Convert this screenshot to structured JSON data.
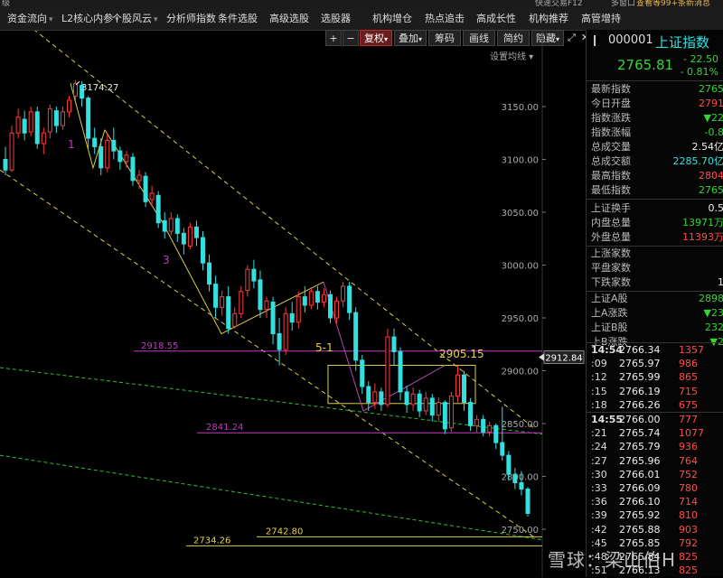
{
  "top_strip": {
    "left_text": "级",
    "right_a": "快速交易F12",
    "right_b": "多窗口",
    "right_c": "查看等99+条新消息"
  },
  "menu": {
    "items": [
      {
        "label": "资金流向",
        "dropdown": true
      },
      {
        "label": "L2核心内参",
        "dropdown": true
      },
      {
        "label": "个股风云",
        "dropdown": true
      },
      {
        "label": "分析师指数",
        "dropdown": false
      },
      {
        "label": "条件选股",
        "dropdown": false
      },
      {
        "label": "高级选股",
        "dropdown": false
      },
      {
        "label": "选股器",
        "dropdown": false
      },
      {
        "label": "机构增仓",
        "dropdown": false
      },
      {
        "label": "热点追击",
        "dropdown": false
      },
      {
        "label": "高成长性",
        "dropdown": false
      },
      {
        "label": "机构推荐",
        "dropdown": false
      },
      {
        "label": "高管增持",
        "dropdown": false
      }
    ]
  },
  "toolbar": {
    "plus": "+",
    "minus": "−",
    "fuquan": "复权",
    "diejia": "叠加",
    "chouma": "筹码",
    "huaxian": "画线",
    "jiantou": "简约",
    "yincang": "隐藏",
    "expand_icon": "expand-icon",
    "close_icon": "close-icon"
  },
  "settings_label": "设置均线",
  "chart_data": {
    "type": "candlestick",
    "ylim": [
      2730,
      3210
    ],
    "ticks": [
      3150,
      3100,
      3050,
      3000,
      2950,
      2900,
      2850,
      2800,
      2750
    ],
    "tick_labels": [
      "3150.00",
      "3100.00",
      "3050.00",
      "3000.00",
      "2950.00",
      "2900.00",
      "2850.00",
      "2800.00",
      "2750.00"
    ],
    "current_price_label": "2912.84",
    "current_price": 2912.84,
    "candles": [
      {
        "o": 3100,
        "h": 3112,
        "c": 3090,
        "l": 3085
      },
      {
        "o": 3090,
        "h": 3132,
        "c": 3125,
        "l": 3088
      },
      {
        "o": 3125,
        "h": 3148,
        "c": 3140,
        "l": 3120
      },
      {
        "o": 3138,
        "h": 3146,
        "c": 3125,
        "l": 3118
      },
      {
        "o": 3126,
        "h": 3150,
        "c": 3145,
        "l": 3122
      },
      {
        "o": 3145,
        "h": 3150,
        "c": 3115,
        "l": 3110
      },
      {
        "o": 3115,
        "h": 3130,
        "c": 3125,
        "l": 3105
      },
      {
        "o": 3126,
        "h": 3152,
        "c": 3148,
        "l": 3120
      },
      {
        "o": 3146,
        "h": 3150,
        "c": 3132,
        "l": 3125
      },
      {
        "o": 3132,
        "h": 3150,
        "c": 3145,
        "l": 3128
      },
      {
        "o": 3145,
        "h": 3160,
        "c": 3156,
        "l": 3140
      },
      {
        "o": 3160,
        "h": 3175,
        "c": 3172,
        "l": 3155
      },
      {
        "o": 3170,
        "h": 3174,
        "c": 3158,
        "l": 3150
      },
      {
        "o": 3158,
        "h": 3160,
        "c": 3120,
        "l": 3110
      },
      {
        "o": 3120,
        "h": 3130,
        "c": 3112,
        "l": 3105
      },
      {
        "o": 3112,
        "h": 3120,
        "c": 3092,
        "l": 3085
      },
      {
        "o": 3092,
        "h": 3125,
        "c": 3118,
        "l": 3088
      },
      {
        "o": 3118,
        "h": 3130,
        "c": 3108,
        "l": 3100
      },
      {
        "o": 3108,
        "h": 3112,
        "c": 3098,
        "l": 3090
      },
      {
        "o": 3098,
        "h": 3108,
        "c": 3104,
        "l": 3092
      },
      {
        "o": 3102,
        "h": 3106,
        "c": 3080,
        "l": 3075
      },
      {
        "o": 3080,
        "h": 3090,
        "c": 3085,
        "l": 3072
      },
      {
        "o": 3084,
        "h": 3088,
        "c": 3060,
        "l": 3055
      },
      {
        "o": 3062,
        "h": 3075,
        "c": 3068,
        "l": 3055
      },
      {
        "o": 3066,
        "h": 3070,
        "c": 3040,
        "l": 3035
      },
      {
        "o": 3042,
        "h": 3050,
        "c": 3032,
        "l": 3025
      },
      {
        "o": 3032,
        "h": 3050,
        "c": 3044,
        "l": 3028
      },
      {
        "o": 3044,
        "h": 3048,
        "c": 3030,
        "l": 3022
      },
      {
        "o": 3030,
        "h": 3035,
        "c": 3020,
        "l": 3010
      },
      {
        "o": 3018,
        "h": 3040,
        "c": 3036,
        "l": 3015
      },
      {
        "o": 3036,
        "h": 3042,
        "c": 3026,
        "l": 3018
      },
      {
        "o": 3026,
        "h": 3032,
        "c": 3002,
        "l": 2995
      },
      {
        "o": 3002,
        "h": 3010,
        "c": 2982,
        "l": 2975
      },
      {
        "o": 2982,
        "h": 2990,
        "c": 2960,
        "l": 2950
      },
      {
        "o": 2960,
        "h": 2976,
        "c": 2970,
        "l": 2952
      },
      {
        "o": 2970,
        "h": 2980,
        "c": 2940,
        "l": 2935
      },
      {
        "o": 2942,
        "h": 2960,
        "c": 2954,
        "l": 2940
      },
      {
        "o": 2954,
        "h": 2980,
        "c": 2975,
        "l": 2950
      },
      {
        "o": 2976,
        "h": 3000,
        "c": 2996,
        "l": 2970
      },
      {
        "o": 2996,
        "h": 3005,
        "c": 2985,
        "l": 2978
      },
      {
        "o": 2986,
        "h": 2995,
        "c": 2958,
        "l": 2950
      },
      {
        "o": 2958,
        "h": 2970,
        "c": 2966,
        "l": 2950
      },
      {
        "o": 2965,
        "h": 2970,
        "c": 2935,
        "l": 2925
      },
      {
        "o": 2935,
        "h": 2950,
        "c": 2920,
        "l": 2905
      },
      {
        "o": 2920,
        "h": 2960,
        "c": 2954,
        "l": 2915
      },
      {
        "o": 2954,
        "h": 2965,
        "c": 2946,
        "l": 2938
      },
      {
        "o": 2946,
        "h": 2975,
        "c": 2970,
        "l": 2940
      },
      {
        "o": 2970,
        "h": 2980,
        "c": 2962,
        "l": 2955
      },
      {
        "o": 2962,
        "h": 2978,
        "c": 2975,
        "l": 2958
      },
      {
        "o": 2975,
        "h": 2980,
        "c": 2965,
        "l": 2958
      },
      {
        "o": 2965,
        "h": 2978,
        "c": 2972,
        "l": 2960
      },
      {
        "o": 2972,
        "h": 2976,
        "c": 2950,
        "l": 2945
      },
      {
        "o": 2950,
        "h": 2970,
        "c": 2966,
        "l": 2945
      },
      {
        "o": 2966,
        "h": 2984,
        "c": 2980,
        "l": 2960
      },
      {
        "o": 2980,
        "h": 2984,
        "c": 2955,
        "l": 2948
      },
      {
        "o": 2955,
        "h": 2960,
        "c": 2910,
        "l": 2900
      },
      {
        "o": 2910,
        "h": 2915,
        "c": 2885,
        "l": 2878
      },
      {
        "o": 2885,
        "h": 2890,
        "c": 2870,
        "l": 2862
      },
      {
        "o": 2870,
        "h": 2888,
        "c": 2880,
        "l": 2864
      },
      {
        "o": 2880,
        "h": 2884,
        "c": 2868,
        "l": 2862
      },
      {
        "o": 2868,
        "h": 2940,
        "c": 2932,
        "l": 2865
      },
      {
        "o": 2932,
        "h": 2940,
        "c": 2918,
        "l": 2905
      },
      {
        "o": 2918,
        "h": 2922,
        "c": 2880,
        "l": 2872
      },
      {
        "o": 2880,
        "h": 2886,
        "c": 2868,
        "l": 2860
      },
      {
        "o": 2868,
        "h": 2884,
        "c": 2878,
        "l": 2862
      },
      {
        "o": 2878,
        "h": 2882,
        "c": 2862,
        "l": 2856
      },
      {
        "o": 2862,
        "h": 2880,
        "c": 2874,
        "l": 2858
      },
      {
        "o": 2874,
        "h": 2878,
        "c": 2858,
        "l": 2852
      },
      {
        "o": 2858,
        "h": 2875,
        "c": 2870,
        "l": 2852
      },
      {
        "o": 2870,
        "h": 2872,
        "c": 2845,
        "l": 2840
      },
      {
        "o": 2846,
        "h": 2880,
        "c": 2876,
        "l": 2842
      },
      {
        "o": 2876,
        "h": 2905,
        "c": 2896,
        "l": 2870
      },
      {
        "o": 2896,
        "h": 2900,
        "c": 2870,
        "l": 2862
      },
      {
        "o": 2870,
        "h": 2874,
        "c": 2848,
        "l": 2843
      },
      {
        "o": 2848,
        "h": 2858,
        "c": 2854,
        "l": 2842
      },
      {
        "o": 2854,
        "h": 2858,
        "c": 2842,
        "l": 2838
      },
      {
        "o": 2842,
        "h": 2852,
        "c": 2848,
        "l": 2838
      },
      {
        "o": 2848,
        "h": 2850,
        "c": 2832,
        "l": 2826
      },
      {
        "o": 2832,
        "h": 2866,
        "c": 2820,
        "l": 2815
      },
      {
        "o": 2820,
        "h": 2824,
        "c": 2802,
        "l": 2796
      },
      {
        "o": 2802,
        "h": 2808,
        "c": 2794,
        "l": 2788
      },
      {
        "o": 2794,
        "h": 2805,
        "c": 2788,
        "l": 2782
      },
      {
        "o": 2788,
        "h": 2790,
        "c": 2765,
        "l": 2762
      }
    ],
    "annotations": {
      "high_label": "3174.27",
      "wave_1": "1",
      "wave_3": "3",
      "wave_5_1": "5-1",
      "level_2918": "2918.55",
      "level_2905": "2905.15",
      "level_2841": "2841.24",
      "level_2742": "2742.80",
      "level_2734": "2734.26"
    },
    "levels": {
      "l2918": 2918.55,
      "l2905": 2905.15,
      "l2841": 2841.24,
      "l2742": 2742.8,
      "l2734": 2734.26
    },
    "colors": {
      "up": "#ff3b3b",
      "down": "#33e0e0",
      "channel": "#d8cf4a",
      "level": "#c23ac2",
      "green_line": "#2fbf2f",
      "grid": "#2a2a2a"
    }
  },
  "quote": {
    "code": "000001",
    "name": "上证指数",
    "price": "2765.81",
    "change": "- 22.50",
    "change_pct": "- 0.81%",
    "rows": [
      {
        "label": "最新指数",
        "value": "2765",
        "cls": "dn"
      },
      {
        "label": "今日开盘",
        "value": "2791",
        "cls": "up"
      },
      {
        "label": "指数涨跌",
        "value": "▼22",
        "cls": "dn"
      },
      {
        "label": "指数涨幅",
        "value": "-0.8",
        "cls": "dn"
      },
      {
        "label": "总成交量",
        "value": "2.54亿",
        "cls": "wt"
      },
      {
        "label": "总成交额",
        "value": "2285.70亿",
        "cls": "cy"
      },
      {
        "label": "最高指数",
        "value": "2804",
        "cls": "up"
      },
      {
        "label": "最低指数",
        "value": "2765",
        "cls": "dn"
      },
      {
        "label": "上证换手",
        "value": "0.5",
        "cls": "wt"
      },
      {
        "label": "内盘总量",
        "value": "13971万",
        "cls": "dn"
      },
      {
        "label": "外盘总量",
        "value": "11393万",
        "cls": "up"
      },
      {
        "label": "上涨家数",
        "value": "",
        "cls": "wt"
      },
      {
        "label": "平盘家数",
        "value": "",
        "cls": "wt"
      },
      {
        "label": "下跌家数",
        "value": "1",
        "cls": "wt"
      },
      {
        "label": "上证A股",
        "value": "2898",
        "cls": "dn"
      },
      {
        "label": "上A涨跌",
        "value": "▼23",
        "cls": "dn"
      },
      {
        "label": "上证B股",
        "value": "232",
        "cls": "dn"
      },
      {
        "label": "上B涨跌",
        "value": "▼2",
        "cls": "dn"
      }
    ],
    "trades": [
      {
        "t": "14:54",
        "p": "2766.34",
        "v": "1357",
        "bold": true
      },
      {
        "t": ":09",
        "p": "2765.97",
        "v": "986"
      },
      {
        "t": ":12",
        "p": "2765.99",
        "v": "865"
      },
      {
        "t": ":15",
        "p": "2766.19",
        "v": "715"
      },
      {
        "t": ":18",
        "p": "2766.26",
        "v": "675"
      },
      {
        "t": "14:55",
        "p": "2766.00",
        "v": "777",
        "bold": true
      },
      {
        "t": ":21",
        "p": "2765.74",
        "v": "1077"
      },
      {
        "t": ":24",
        "p": "2765.79",
        "v": "936"
      },
      {
        "t": ":27",
        "p": "2765.96",
        "v": "764"
      },
      {
        "t": ":30",
        "p": "2766.01",
        "v": "752"
      },
      {
        "t": ":33",
        "p": "2766.09",
        "v": "780"
      },
      {
        "t": ":36",
        "p": "2766.10",
        "v": "714"
      },
      {
        "t": ":39",
        "p": "2765.92",
        "v": "810"
      },
      {
        "t": ":42",
        "p": "2765.88",
        "v": "903"
      },
      {
        "t": ":45",
        "p": "2765.85",
        "v": "792"
      },
      {
        "t": ":48",
        "p": "2765.84",
        "v": "825"
      },
      {
        "t": ":51",
        "p": "2766.13",
        "v": "825"
      }
    ]
  },
  "watermark": "雪球：梁山伯H"
}
